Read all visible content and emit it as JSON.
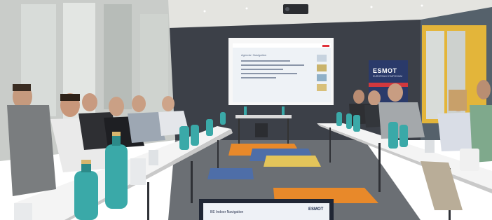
{
  "image": {
    "width": 702,
    "height": 314
  },
  "slide": {
    "title": "Agenda / Navigation"
  },
  "banner": {
    "logo": "ESMOT",
    "subtitle": "EUROPEAN SYMPOSIUM"
  },
  "laptop": {
    "screen_title": "BE Indoor Navigation",
    "logo": "ESMOT"
  },
  "colors": {
    "ceiling": "#e4e4e0",
    "wall_left": "#c9ccc9",
    "wall_back": "#3c4048",
    "table": "#f4f4f4",
    "carpet_orange": "#e8892a",
    "carpet_blue": "#4e6ea8",
    "bottle_teal": "#3aa9a8",
    "projector_screen": "#eef2f6",
    "yellow_cabinet": "#e3b53a"
  },
  "scene": {
    "caption": ""
  }
}
